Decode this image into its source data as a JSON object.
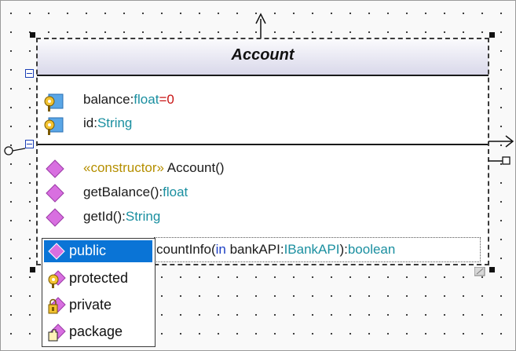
{
  "class": {
    "name": "Account",
    "attributes": [
      {
        "name": "balance",
        "separator": ":",
        "type": "float",
        "default_sep": "=",
        "default": "0"
      },
      {
        "name": "id",
        "separator": ":",
        "type": "String"
      }
    ],
    "operations": [
      {
        "stereotype": "«constructor»",
        "name": " Account()",
        "type": ""
      },
      {
        "name": "getBalance()",
        "separator": ":",
        "type": "float"
      },
      {
        "name": "getId()",
        "separator": ":",
        "type": "String"
      }
    ],
    "edited_operation": {
      "prefix": "countInfo(",
      "keyword": "in",
      "param": " bankAPI:",
      "param_type": "IBankAPI",
      "suffix": "):",
      "return_type": "boolean"
    }
  },
  "visibility_menu": {
    "items": [
      {
        "label": "public",
        "icon": "public-visibility-icon",
        "selected": true
      },
      {
        "label": "protected",
        "icon": "protected-visibility-icon",
        "selected": false
      },
      {
        "label": "private",
        "icon": "private-visibility-icon",
        "selected": false
      },
      {
        "label": "package",
        "icon": "package-visibility-icon",
        "selected": false
      }
    ]
  },
  "colors": {
    "header_top": "#fbfbfd",
    "header_bottom": "#d9d8ea",
    "type_color": "#1a8fa0",
    "default_value_color": "#c81414",
    "stereotype_color": "#b58f00",
    "keyword_color": "#1c3fc4",
    "selection": "#0a74d6",
    "operation_icon": "#d86fe0"
  }
}
